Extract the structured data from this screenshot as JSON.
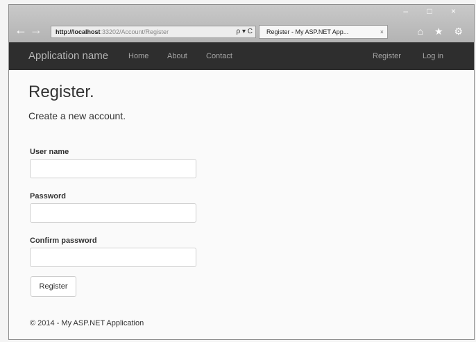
{
  "browser": {
    "address_host": "http://localhost",
    "address_path": ":33202/Account/Register",
    "address_icons": "ρ ▾ C",
    "tab_title": "Register - My ASP.NET App...",
    "tab_close": "×",
    "window_controls": "– □ ×",
    "toolbar_icons": "⌂ ★ ⚙"
  },
  "navbar": {
    "brand": "Application name",
    "links": [
      "Home",
      "About",
      "Contact"
    ],
    "right_links": [
      "Register",
      "Log in"
    ]
  },
  "page": {
    "title": "Register.",
    "subtitle": "Create a new account."
  },
  "form": {
    "username_label": "User name",
    "username_value": "",
    "password_label": "Password",
    "password_value": "",
    "confirm_label": "Confirm password",
    "confirm_value": "",
    "submit_label": "Register"
  },
  "footer": {
    "text": "© 2014 - My ASP.NET Application"
  }
}
